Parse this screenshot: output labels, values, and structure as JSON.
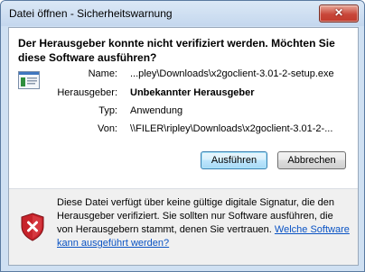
{
  "window": {
    "title": "Datei öffnen - Sicherheitswarnung",
    "close_symbol": "✕"
  },
  "heading": "Der Herausgeber konnte nicht verifiziert werden. Möchten Sie diese Software ausführen?",
  "icons": {
    "app": "application-file-icon",
    "warning": "security-shield-warning-icon",
    "close": "close-icon"
  },
  "details": {
    "name_label": "Name:",
    "name_value": "...pley\\Downloads\\x2goclient-3.01-2-setup.exe",
    "publisher_label": "Herausgeber:",
    "publisher_value": "Unbekannter Herausgeber",
    "type_label": "Typ:",
    "type_value": "Anwendung",
    "from_label": "Von:",
    "from_value": "\\\\FILER\\ripley\\Downloads\\x2goclient-3.01-2-..."
  },
  "buttons": {
    "run_label": "Ausführen",
    "cancel_label": "Abbrechen"
  },
  "warning": {
    "text": "Diese Datei verfügt über keine gültige digitale Signatur, die den Herausgeber verifiziert. Sie sollten nur Software ausführen, die von Herausgebern stammt, denen Sie vertrauen. ",
    "link": "Welche Software kann ausgeführt werden?"
  },
  "colors": {
    "link": "#0a53c4",
    "close_button": "#c8473a",
    "frame": "#cfe0f2"
  }
}
